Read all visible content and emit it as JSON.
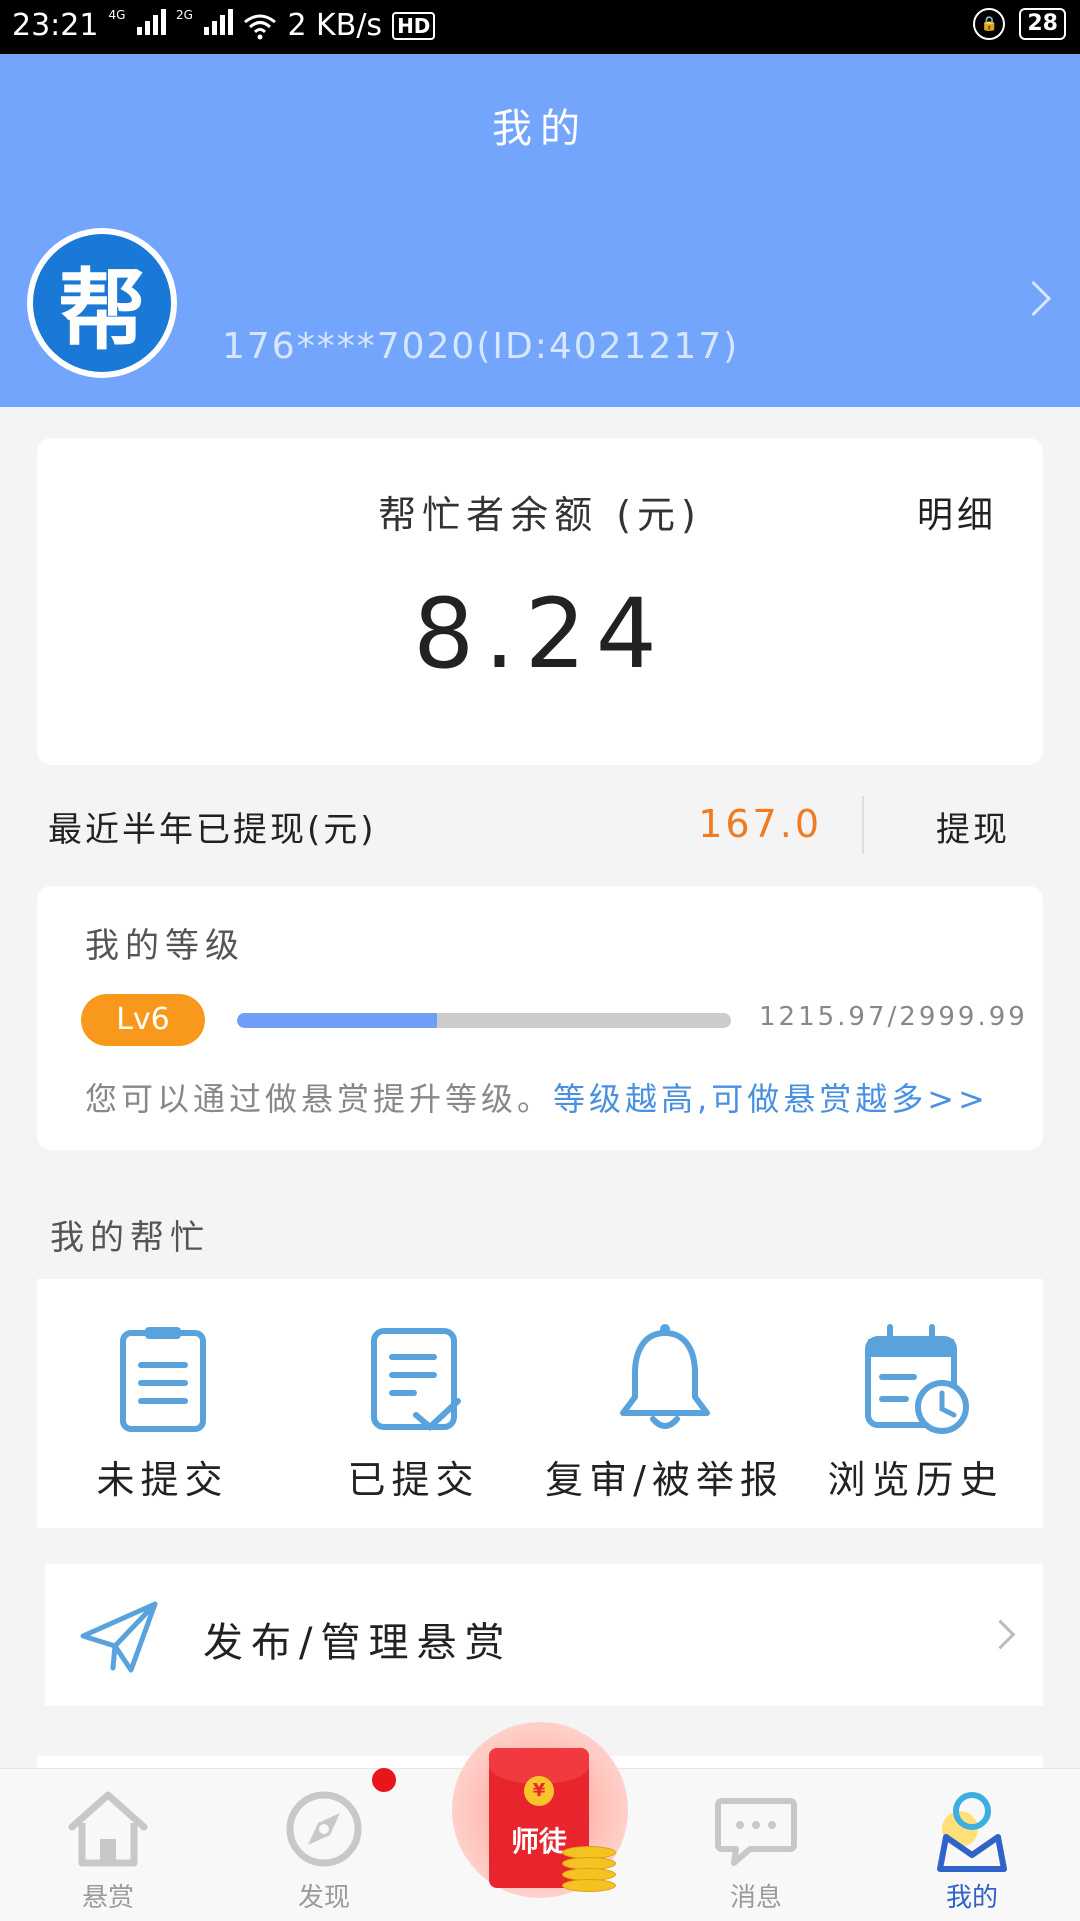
{
  "status_bar": {
    "time": "23:21",
    "net1": "4G",
    "net2": "2G",
    "speed": "2 KB/s",
    "hd": "HD",
    "battery": "28"
  },
  "header": {
    "title": "我的",
    "user_id": "176****7020(ID:4021217)",
    "avatar_text": "帮"
  },
  "balance": {
    "label": "帮忙者余额 (元)",
    "detail_label": "明细",
    "amount": "8.24"
  },
  "withdraw": {
    "label": "最近半年已提现(元)",
    "value": "167.0",
    "button_label": "提现"
  },
  "level": {
    "title": "我的等级",
    "badge": "Lv6",
    "progress_fraction": 0.405,
    "value_text": "1215.97/2999.99",
    "tip_gray": "您可以通过做悬赏提升等级。",
    "tip_blue": "等级越高,可做悬赏越多>>"
  },
  "my_help": {
    "title": "我的帮忙",
    "items": [
      {
        "label": "未提交",
        "icon": "clipboard-icon"
      },
      {
        "label": "已提交",
        "icon": "document-check-icon"
      },
      {
        "label": "复审/被举报",
        "icon": "bell-icon"
      },
      {
        "label": "浏览历史",
        "icon": "calendar-clock-icon"
      }
    ]
  },
  "publish": {
    "label": "发布/管理悬赏",
    "icon": "paper-plane-icon"
  },
  "bottom_nav": {
    "items": [
      {
        "label": "悬赏",
        "icon": "home-icon"
      },
      {
        "label": "发现",
        "icon": "discover-icon"
      },
      {
        "label": "师徒",
        "icon": "red-envelope-icon"
      },
      {
        "label": "消息",
        "icon": "message-icon"
      },
      {
        "label": "我的",
        "icon": "profile-icon"
      }
    ]
  },
  "colors": {
    "header_bg": "#72a5fb",
    "accent_orange": "#ef7b22",
    "badge_orange": "#f8981d",
    "link_blue": "#4a90e2",
    "icon_blue": "#5aa2dc",
    "active_nav": "#2f63c9"
  }
}
